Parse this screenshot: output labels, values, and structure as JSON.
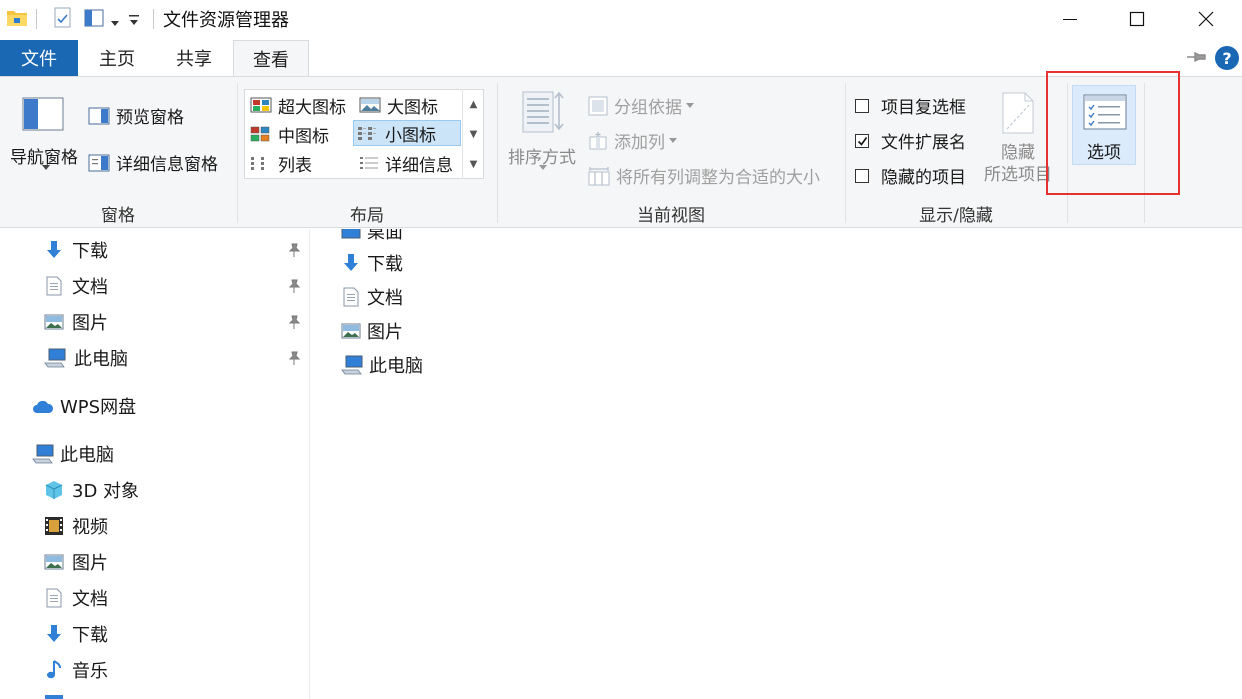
{
  "window": {
    "title": "文件资源管理器"
  },
  "tabs": {
    "file": "文件",
    "home": "主页",
    "share": "共享",
    "view": "查看"
  },
  "ribbon": {
    "pane_group": {
      "label": "窗格",
      "nav_pane": "导航窗格",
      "preview_pane": "预览窗格",
      "details_pane": "详细信息窗格"
    },
    "layout_group": {
      "label": "布局",
      "extra_large_icons": "超大图标",
      "large_icons": "大图标",
      "medium_icons": "中图标",
      "small_icons": "小图标",
      "list": "列表",
      "details": "详细信息",
      "selected": "小图标"
    },
    "current_view_group": {
      "label": "当前视图",
      "sort_by": "排序方式",
      "group_by": "分组依据",
      "add_columns": "添加列",
      "size_all_columns": "将所有列调整为合适的大小"
    },
    "show_hide_group": {
      "label": "显示/隐藏",
      "item_checkboxes": "项目复选框",
      "item_checkboxes_checked": false,
      "file_extensions": "文件扩展名",
      "file_extensions_checked": true,
      "hidden_items": "隐藏的项目",
      "hidden_items_checked": false,
      "hide_selected_line1": "隐藏",
      "hide_selected_line2": "所选项目"
    },
    "options_label": "选项"
  },
  "nav_pane": {
    "quick_access": [
      {
        "label": "下载",
        "icon": "download-icon",
        "pinned": true
      },
      {
        "label": "文档",
        "icon": "document-icon",
        "pinned": true
      },
      {
        "label": "图片",
        "icon": "picture-icon",
        "pinned": true
      },
      {
        "label": "此电脑",
        "icon": "computer-icon",
        "pinned": true
      }
    ],
    "wps": "WPS网盘",
    "this_pc": "此电脑",
    "this_pc_children": [
      {
        "label": "3D 对象",
        "icon": "3d-objects-icon"
      },
      {
        "label": "视频",
        "icon": "video-icon"
      },
      {
        "label": "图片",
        "icon": "picture-icon"
      },
      {
        "label": "文档",
        "icon": "document-icon"
      },
      {
        "label": "下载",
        "icon": "download-icon"
      },
      {
        "label": "音乐",
        "icon": "music-icon"
      }
    ]
  },
  "main_pane": {
    "items": [
      {
        "label": "桌面",
        "icon": "desktop-icon"
      },
      {
        "label": "下载",
        "icon": "download-icon"
      },
      {
        "label": "文档",
        "icon": "document-icon"
      },
      {
        "label": "图片",
        "icon": "picture-icon"
      },
      {
        "label": "此电脑",
        "icon": "computer-icon"
      }
    ]
  },
  "colors": {
    "accent": "#1a67b4",
    "ribbon_bg": "#f5f6f7",
    "selected_bg": "#cce4f7",
    "highlight": "#e5312f"
  }
}
